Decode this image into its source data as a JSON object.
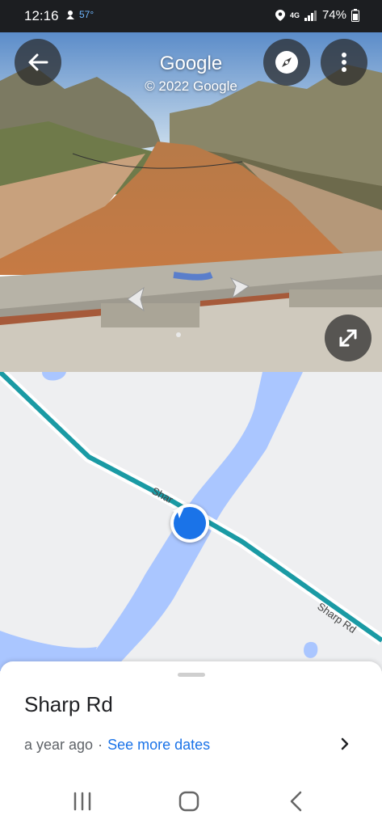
{
  "status_bar": {
    "time": "12:16",
    "temperature": "57°",
    "network": "4G",
    "battery": "74%"
  },
  "street_view": {
    "title": "Google",
    "copyright": "© 2022 Google"
  },
  "map": {
    "road_label_1": "Shar",
    "road_label_2": "Sharp Rd"
  },
  "place": {
    "title": "Sharp Rd",
    "date": "a year ago",
    "separator": "·",
    "see_more": "See more dates"
  },
  "colors": {
    "accent": "#1a73e8",
    "road": "#1a9aa4",
    "water": "#aac6ff",
    "map_background": "#eeeff1"
  }
}
